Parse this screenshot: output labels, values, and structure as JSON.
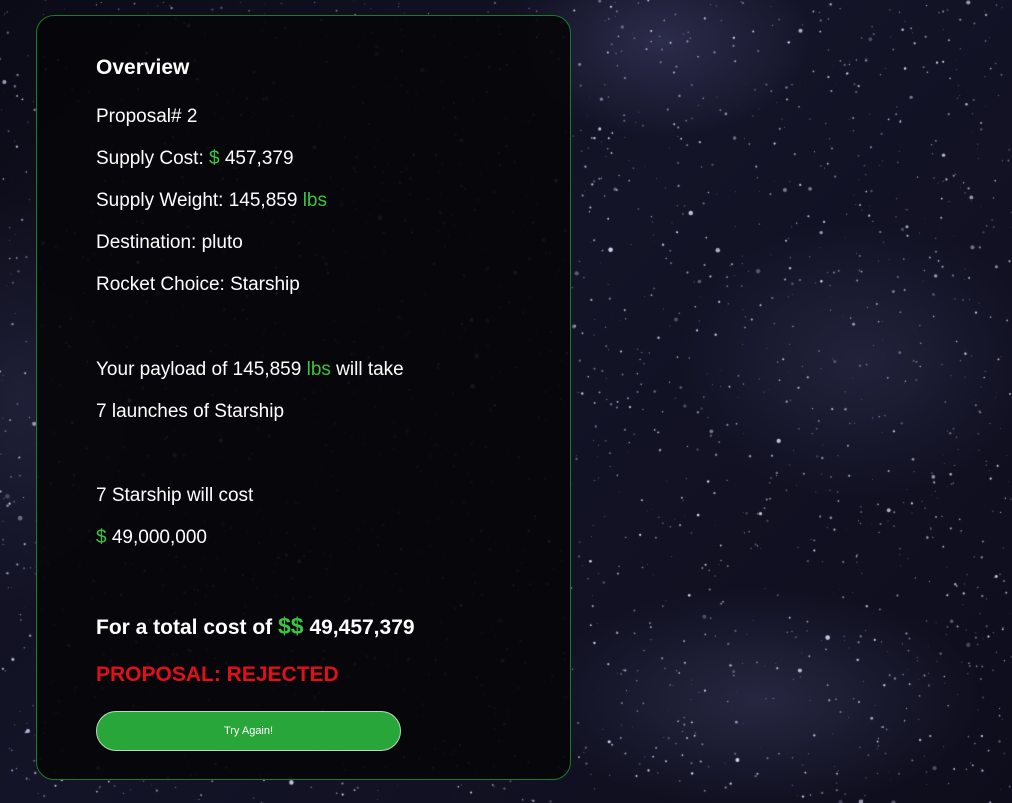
{
  "overview": {
    "title": "Overview",
    "proposal_label": "Proposal# 2",
    "supply_cost": {
      "label": "Supply Cost: ",
      "currency": "$",
      "value": " 457,379"
    },
    "supply_weight": {
      "label": "Supply Weight: 145,859 ",
      "unit": "lbs"
    },
    "destination": "Destination: pluto",
    "rocket_choice": "Rocket Choice: Starship"
  },
  "payload": {
    "prefix": "Your payload of 145,859 ",
    "unit": "lbs",
    "suffix": " will take",
    "launches": "7 launches of Starship"
  },
  "rocket_cost": {
    "line": "7 Starship will cost",
    "currency": "$",
    "value": " 49,000,000"
  },
  "total": {
    "prefix": "For a total cost of ",
    "currency": "$$",
    "value": " 49,457,379"
  },
  "status": "PROPOSAL: REJECTED",
  "button": {
    "label": "Try Again!"
  },
  "colors": {
    "accent_green": "#3ac43f",
    "rejected_red": "#e0101a",
    "button_green": "#29a63a",
    "card_border": "#1e7a2a"
  }
}
